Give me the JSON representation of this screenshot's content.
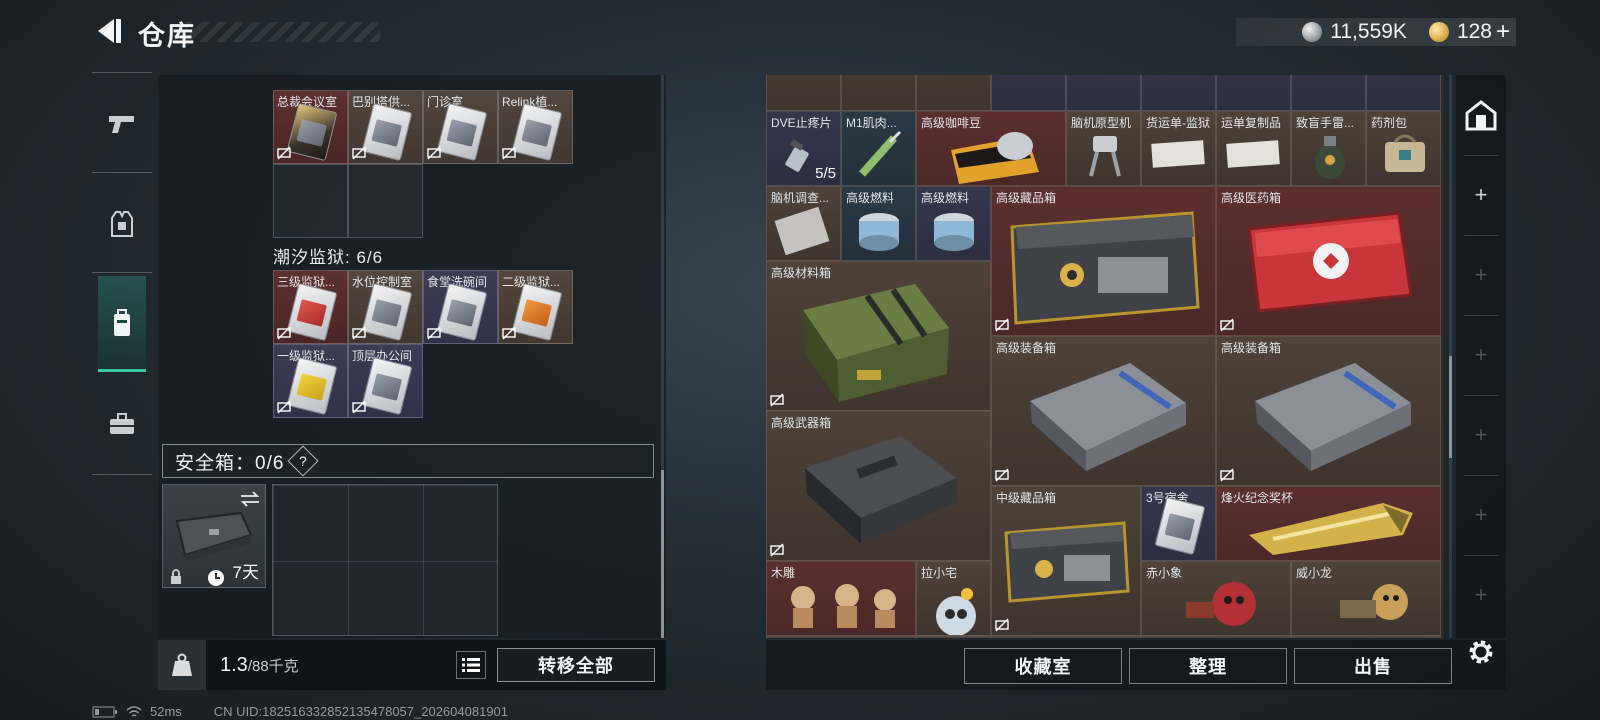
{
  "header": {
    "title": "仓库",
    "currency": [
      {
        "icon": "silver-coin-icon",
        "value": "11,559K"
      },
      {
        "icon": "gold-coin-icon",
        "value": "128"
      }
    ],
    "add_currency": "+"
  },
  "left_nav": [
    {
      "icon": "pistol-icon"
    },
    {
      "icon": "vest-icon"
    },
    {
      "icon": "backpack-icon",
      "active": true
    },
    {
      "icon": "briefcase-icon"
    }
  ],
  "key_sections": [
    {
      "title": "",
      "cells": [
        {
          "label": "总裁会议室",
          "color": "red",
          "card": "gold"
        },
        {
          "label": "巴别塔供...",
          "color": "brown",
          "card": "silver"
        },
        {
          "label": "门诊室",
          "color": "brown",
          "card": "silver"
        },
        {
          "label": "Relink植...",
          "color": "brown",
          "card": "silver"
        }
      ]
    },
    {
      "title": "潮汐监狱: 6/6",
      "cells": [
        {
          "label": "三级监狱...",
          "color": "red",
          "card": "red"
        },
        {
          "label": "水位控制室",
          "color": "brown",
          "card": "silver"
        },
        {
          "label": "食堂洗碗间",
          "color": "purple",
          "card": "silver"
        },
        {
          "label": "二级监狱...",
          "color": "brown",
          "card": "orange"
        },
        {
          "label": "一级监狱...",
          "color": "purple",
          "card": "yellow"
        },
        {
          "label": "顶层办公间",
          "color": "purple",
          "card": "silver"
        }
      ]
    }
  ],
  "safe_box": {
    "label": "安全箱：0/6",
    "help": "?",
    "duration": "7天"
  },
  "weight": {
    "current": "1.3",
    "max": "/88千克"
  },
  "buttons": {
    "transfer_all": "转移全部",
    "collection": "收藏室",
    "organize": "整理",
    "sell": "出售"
  },
  "status": {
    "ping": "52ms",
    "uid": "CN UID:182516332852135478057_202604081901"
  },
  "stash_items": [
    {
      "id": "dve",
      "label": "DVE止疼片",
      "color": "purple",
      "count": "5/5"
    },
    {
      "id": "m1",
      "label": "M1肌肉...",
      "color": "blue"
    },
    {
      "id": "coffee",
      "label": "高级咖啡豆",
      "color": "red"
    },
    {
      "id": "brainproto",
      "label": "脑机原型机",
      "color": "brown"
    },
    {
      "id": "manifest",
      "label": "货运单-监狱",
      "color": "brown"
    },
    {
      "id": "copy",
      "label": "运单复制品",
      "color": "brown"
    },
    {
      "id": "grenade",
      "label": "致盲手雷...",
      "color": "brown"
    },
    {
      "id": "medbag",
      "label": "药剂包",
      "color": "brown"
    },
    {
      "id": "brainsurvey",
      "label": "脑机调查...",
      "color": "brown"
    },
    {
      "id": "fuel1",
      "label": "高级燃料",
      "color": "blue"
    },
    {
      "id": "fuel2",
      "label": "高级燃料",
      "color": "purple"
    },
    {
      "id": "collect1",
      "label": "高级藏品箱",
      "color": "red"
    },
    {
      "id": "medbox",
      "label": "高级医药箱",
      "color": "red"
    },
    {
      "id": "material",
      "label": "高级材料箱",
      "color": "brown"
    },
    {
      "id": "equip1",
      "label": "高级装备箱",
      "color": "brown"
    },
    {
      "id": "equip2",
      "label": "高级装备箱",
      "color": "brown"
    },
    {
      "id": "weapon",
      "label": "高级武器箱",
      "color": "brown"
    },
    {
      "id": "collect2",
      "label": "中级藏品箱",
      "color": "brown"
    },
    {
      "id": "dorm",
      "label": "3号宿舍",
      "color": "purple"
    },
    {
      "id": "trophy",
      "label": "烽火纪念奖杯",
      "color": "red"
    },
    {
      "id": "carving",
      "label": "木雕",
      "color": "red"
    },
    {
      "id": "lazhai",
      "label": "拉小宅",
      "color": "brown"
    },
    {
      "id": "chixiaoxiang",
      "label": "赤小象",
      "color": "brown"
    },
    {
      "id": "weixiaolong",
      "label": "威小龙",
      "color": "brown"
    }
  ],
  "side_tabs": [
    {
      "icon": "safehouse-icon"
    },
    {
      "icon": "add-tab-icon",
      "symbol": "+"
    },
    {
      "icon": "add-tab-icon",
      "symbol": "+"
    },
    {
      "icon": "add-tab-icon",
      "symbol": "+"
    },
    {
      "icon": "add-tab-icon",
      "symbol": "+"
    },
    {
      "icon": "add-tab-icon",
      "symbol": "+"
    },
    {
      "icon": "add-tab-icon",
      "symbol": "+"
    }
  ]
}
